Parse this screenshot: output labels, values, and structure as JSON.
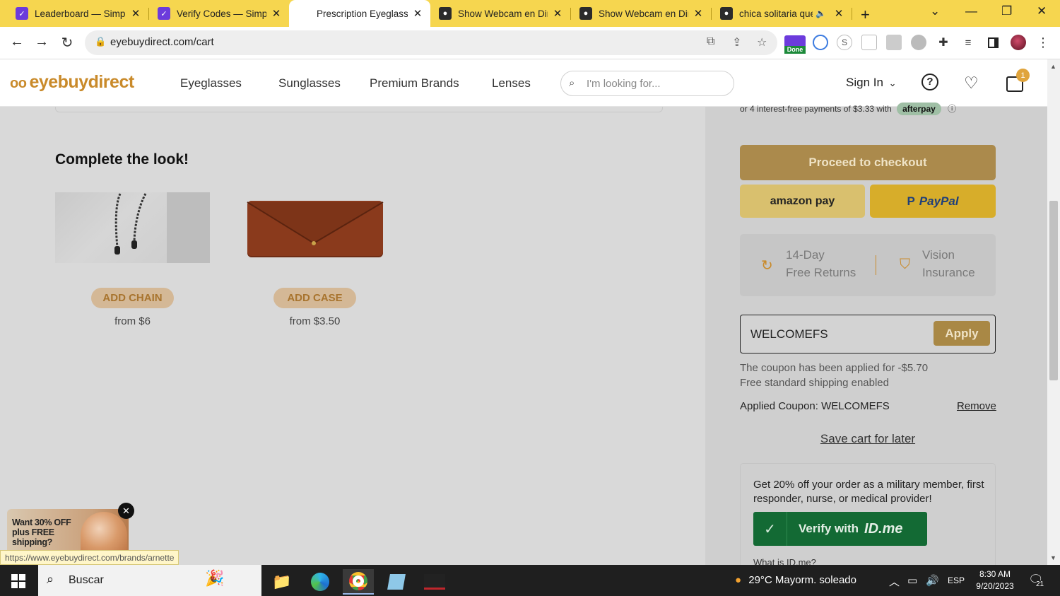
{
  "browser": {
    "tabs": [
      {
        "title": "Leaderboard — Simpl",
        "icon": "simplify-icon",
        "active": false
      },
      {
        "title": "Verify Codes — Simpl",
        "icon": "simplify-icon",
        "active": false
      },
      {
        "title": "Prescription Eyeglasse",
        "icon": "eyebuydirect-icon",
        "active": true
      },
      {
        "title": "Show Webcam en Dir",
        "icon": "webcam-icon",
        "active": false
      },
      {
        "title": "Show Webcam en Dir",
        "icon": "webcam-icon",
        "active": false
      },
      {
        "title": "chica solitaria que",
        "icon": "webcam-icon",
        "active": false
      }
    ],
    "url": "eyebuydirect.com/cart",
    "extension_badge": "Done"
  },
  "site": {
    "logo": "eyebuydirect",
    "nav": [
      "Eyeglasses",
      "Sunglasses",
      "Premium Brands",
      "Lenses"
    ],
    "search_placeholder": "I'm looking for...",
    "sign_in": "Sign In",
    "cart_count": "1"
  },
  "main": {
    "complete_title": "Complete the look!",
    "products": [
      {
        "button": "ADD CHAIN",
        "price": "from $6"
      },
      {
        "button": "ADD CASE",
        "price": "from $3.50"
      }
    ]
  },
  "sidebar": {
    "afterpay_text": "or 4 interest-free payments of $3.33 with",
    "afterpay_brand": "afterpay",
    "checkout": "Proceed to checkout",
    "amazon_pay": "amazon pay",
    "paypal": "PayPal",
    "benefit1_line1": "14-Day",
    "benefit1_line2": "Free Returns",
    "benefit2_line1": "Vision",
    "benefit2_line2": "Insurance",
    "coupon_code": "WELCOMEFS",
    "apply": "Apply",
    "coupon_msg": "The coupon has been applied for -$5.70",
    "shipping_msg": "Free standard shipping enabled",
    "applied_coupon": "Applied Coupon: WELCOMEFS",
    "remove": "Remove",
    "save_cart": "Save cart for later",
    "idme_text": "Get 20% off your order as a military member, first responder, nurse, or medical provider!",
    "idme_button": "Verify with",
    "idme_brand": "ID.me",
    "idme_link": "What is ID.me?"
  },
  "promo": {
    "text": "Want 30% OFF plus FREE shipping?"
  },
  "status_url": "https://www.eyebuydirect.com/brands/arnette",
  "taskbar": {
    "search": "Buscar",
    "weather": "29°C  Mayorm. soleado",
    "lang": "ESP",
    "time": "8:30 AM",
    "date": "9/20/2023",
    "notifications": "21"
  },
  "colors": {
    "tabstrip": "#f6d64f",
    "brand": "#c98a2a",
    "checkout": "#ab8a4c",
    "idme_green": "#136a34"
  }
}
